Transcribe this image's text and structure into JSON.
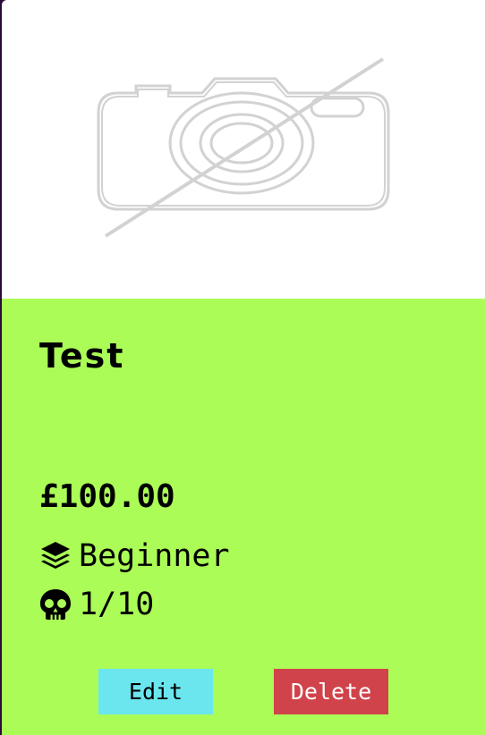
{
  "card": {
    "image": {
      "icon": "no-image-camera-icon"
    },
    "title": "Test",
    "price": "£100.00",
    "level": {
      "icon": "layers-icon",
      "label": "Beginner"
    },
    "difficulty": {
      "icon": "skull-icon",
      "label": "1/10"
    },
    "actions": {
      "edit_label": "Edit",
      "delete_label": "Delete"
    }
  },
  "colors": {
    "card_body": "#abfc56",
    "edit_button": "#6be6ef",
    "delete_button": "#d0434a",
    "page_edge": "#2a0a3a"
  }
}
